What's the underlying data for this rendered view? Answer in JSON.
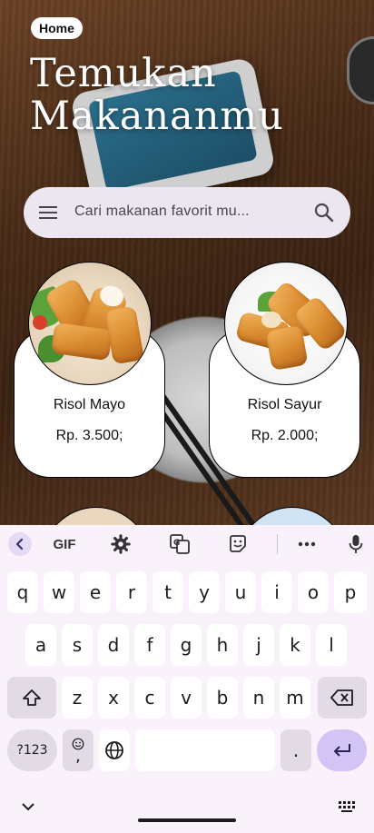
{
  "header": {
    "home_chip": "Home",
    "title_line1": "Temukan",
    "title_line2": "Makananmu"
  },
  "search": {
    "placeholder": "Cari makanan favorit mu..."
  },
  "products": [
    {
      "name": "Risol Mayo",
      "price": "Rp. 3.500;"
    },
    {
      "name": "Risol Sayur",
      "price": "Rp. 2.000;"
    }
  ],
  "keyboard": {
    "toolbar": {
      "gif": "GIF"
    },
    "row1": [
      "q",
      "w",
      "e",
      "r",
      "t",
      "y",
      "u",
      "i",
      "o",
      "p"
    ],
    "row2": [
      "a",
      "s",
      "d",
      "f",
      "g",
      "h",
      "j",
      "k",
      "l"
    ],
    "row3": [
      "z",
      "x",
      "c",
      "v",
      "b",
      "n",
      "m"
    ],
    "symbols": "?123",
    "comma": ",",
    "period": "."
  },
  "colors": {
    "search_bg": "#ece6f0",
    "keyboard_bg": "#faf2fb",
    "enter_key": "#d3c4f6"
  }
}
